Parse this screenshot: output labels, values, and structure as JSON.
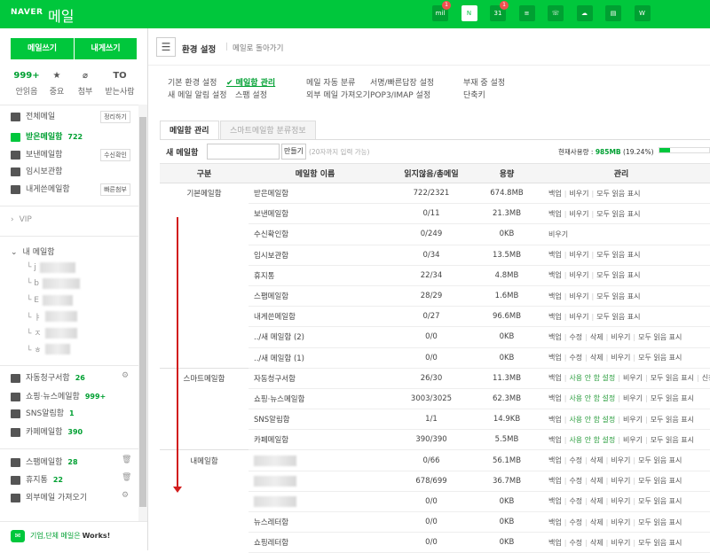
{
  "header": {
    "brand": "NAVER",
    "product": "메일",
    "apps": [
      {
        "icon": "talk-icon",
        "glyph": "mil",
        "badge": "1"
      },
      {
        "icon": "mail-icon",
        "glyph": "N",
        "badge": ""
      },
      {
        "icon": "calendar-icon",
        "glyph": "31",
        "badge": "1"
      },
      {
        "icon": "contacts-icon",
        "glyph": "≡",
        "badge": ""
      },
      {
        "icon": "phone-icon",
        "glyph": "☏",
        "badge": ""
      },
      {
        "icon": "cloud-icon",
        "glyph": "☁",
        "badge": ""
      },
      {
        "icon": "memo-icon",
        "glyph": "▤",
        "badge": ""
      },
      {
        "icon": "home-icon",
        "glyph": "W",
        "badge": ""
      }
    ]
  },
  "sidebar": {
    "compose": "메일쓰기",
    "self_compose": "내게쓰기",
    "quick": [
      {
        "value": "999+",
        "label": "안읽음"
      },
      {
        "value": "★",
        "label": "중요"
      },
      {
        "value": "⌀",
        "label": "첨부"
      },
      {
        "value": "TO",
        "label": "받는사람"
      }
    ],
    "folders": [
      {
        "label": "전체메일",
        "button": "정리하기"
      },
      {
        "label": "받은메일함",
        "count": "722"
      },
      {
        "label": "보낸메일함",
        "button": "수신확인"
      },
      {
        "label": "임시보관함"
      },
      {
        "label": "내게쓴메일함",
        "button": "빠른첨부"
      }
    ],
    "vip": "VIP",
    "my_mailbox": "내 메일함",
    "sub_initials": [
      "j",
      "b",
      "E",
      "ㅑ",
      "ㅈ",
      "ㅎ"
    ],
    "smart": [
      {
        "label": "자동청구서함",
        "count": "26"
      },
      {
        "label": "쇼핑·뉴스메일함",
        "count": "999+"
      },
      {
        "label": "SNS알림함",
        "count": "1"
      },
      {
        "label": "카페메일함",
        "count": "390"
      }
    ],
    "etc": [
      {
        "label": "스팸메일함",
        "count": "28"
      },
      {
        "label": "휴지통",
        "count": "22"
      },
      {
        "label": "외부메일 가져오기"
      }
    ],
    "works_green": "기업,단체 메일은",
    "works_bold": "Works!"
  },
  "main": {
    "title": "환경 설정",
    "back": "메일로 돌아가기",
    "settings_row1": [
      "기본 환경 설정",
      "✔ 메일함 관리",
      "메일 자동 분류",
      "서명/빠른답장 설정",
      "부재 중 설정"
    ],
    "settings_row2": [
      "새 메일 알림 설정",
      "스팸 설정",
      "외부 메일 가져오기",
      "POP3/IMAP 설정",
      "단축키"
    ],
    "tabs": [
      "메일함 관리",
      "스마트메일함 분류정보"
    ],
    "new_label": "새 메일함",
    "create": "만들기",
    "hint": "(20자까지 입력 가능)",
    "usage_label": "현재사용량 :",
    "usage_value": "985MB",
    "usage_pct": "(19.24%)",
    "usage_fraction": 0.1924,
    "columns": [
      "구분",
      "메일함 이름",
      "읽지않음/총메일",
      "용량",
      "관리"
    ],
    "rows": [
      {
        "group": "기본메일함",
        "name": "받은메일함",
        "count": "722/2321",
        "size": "674.8MB",
        "actions": [
          "백업",
          "비우기",
          "모두 읽음 표시"
        ]
      },
      {
        "name": "보낸메일함",
        "count": "0/11",
        "size": "21.3MB",
        "actions": [
          "백업",
          "비우기",
          "모두 읽음 표시"
        ]
      },
      {
        "name": "수신확인함",
        "count": "0/249",
        "size": "0KB",
        "actions": [
          "비우기"
        ]
      },
      {
        "name": "임시보관함",
        "count": "0/34",
        "size": "13.5MB",
        "actions": [
          "백업",
          "비우기",
          "모두 읽음 표시"
        ]
      },
      {
        "name": "휴지통",
        "count": "22/34",
        "size": "4.8MB",
        "actions": [
          "백업",
          "비우기",
          "모두 읽음 표시"
        ]
      },
      {
        "name": "스팸메일함",
        "count": "28/29",
        "size": "1.6MB",
        "actions": [
          "백업",
          "비우기",
          "모두 읽음 표시"
        ]
      },
      {
        "name": "내게쓴메일함",
        "count": "0/27",
        "size": "96.6MB",
        "actions": [
          "백업",
          "비우기",
          "모두 읽음 표시"
        ]
      },
      {
        "name": "../새 메일함 (2)",
        "count": "0/0",
        "size": "0KB",
        "actions": [
          "백업",
          "수정",
          "삭제",
          "비우기",
          "모두 읽음 표시"
        ]
      },
      {
        "name": "../새 메일함 (1)",
        "count": "0/0",
        "size": "0KB",
        "actions": [
          "백업",
          "수정",
          "삭제",
          "비우기",
          "모두 읽음 표시"
        ]
      },
      {
        "group": "스마트메일함",
        "name": "자동청구서함",
        "count": "26/30",
        "size": "11.3MB",
        "actions": [
          "백업",
          "사용 안 함 설정",
          "비우기",
          "모두 읽음 표시",
          "신청하기"
        ]
      },
      {
        "name": "쇼핑·뉴스메일함",
        "count": "3003/3025",
        "size": "62.3MB",
        "actions": [
          "백업",
          "사용 안 함 설정",
          "비우기",
          "모두 읽음 표시"
        ]
      },
      {
        "name": "SNS알림함",
        "count": "1/1",
        "size": "14.9KB",
        "actions": [
          "백업",
          "사용 안 함 설정",
          "비우기",
          "모두 읽음 표시"
        ]
      },
      {
        "name": "카페메일함",
        "count": "390/390",
        "size": "5.5MB",
        "actions": [
          "백업",
          "사용 안 함 설정",
          "비우기",
          "모두 읽음 표시"
        ]
      },
      {
        "group": "내메일함",
        "name": "",
        "blurred": true,
        "count": "0/66",
        "size": "56.1MB",
        "actions": [
          "백업",
          "수정",
          "삭제",
          "비우기",
          "모두 읽음 표시"
        ]
      },
      {
        "name": "",
        "blurred": true,
        "count": "678/699",
        "size": "36.7MB",
        "actions": [
          "백업",
          "수정",
          "삭제",
          "비우기",
          "모두 읽음 표시"
        ]
      },
      {
        "name": "",
        "blurred": true,
        "count": "0/0",
        "size": "0KB",
        "actions": [
          "백업",
          "수정",
          "삭제",
          "비우기",
          "모두 읽음 표시"
        ]
      },
      {
        "name": "뉴스레터함",
        "count": "0/0",
        "size": "0KB",
        "actions": [
          "백업",
          "수정",
          "삭제",
          "비우기",
          "모두 읽음 표시"
        ]
      },
      {
        "name": "쇼핑레터함",
        "count": "0/0",
        "size": "0KB",
        "actions": [
          "백업",
          "수정",
          "삭제",
          "비우기",
          "모두 읽음 표시"
        ]
      }
    ]
  },
  "colors": {
    "brand": "#00c73c",
    "accent_text": "#00a032",
    "arrow": "#d21e1e"
  }
}
